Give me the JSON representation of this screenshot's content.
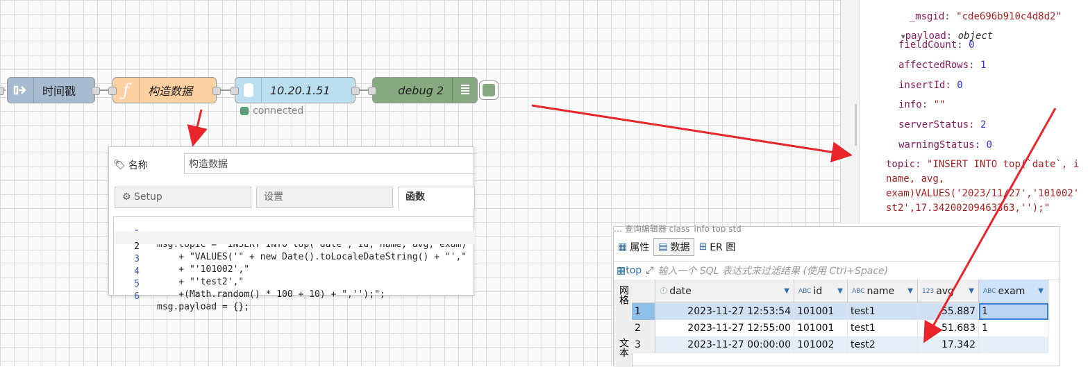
{
  "flow": {
    "nodes": [
      {
        "id": "timestamp",
        "label": "时间戳",
        "color": "#a6bbcf",
        "icon": "arrow-right-icon"
      },
      {
        "id": "function",
        "label": "构造数据",
        "color": "#fdd0a2",
        "icon": "function-icon"
      },
      {
        "id": "mysql",
        "label": "10.20.1.51",
        "color": "#e2d96e",
        "icon": "database-icon"
      },
      {
        "id": "debug",
        "label": "debug 2",
        "color": "#87a980",
        "icon": "list-icon"
      }
    ],
    "mysql_status": "connected"
  },
  "edit_panel": {
    "name_label": "名称",
    "name_value": "构造数据",
    "tabs": [
      "Setup",
      "设置",
      "函数"
    ],
    "code_lines": [
      {
        "n": "1",
        "text": "msg.topic = \"INSERT INTO top(`date`, id, name, avg, exam)\""
      },
      {
        "n": "2",
        "text": "    + \"VALUES('\" + new Date().toLocaleDateString() + \"',\""
      },
      {
        "n": "3",
        "text": "    + \"'101002',\""
      },
      {
        "n": "4",
        "text": "    + \"'test2',\""
      },
      {
        "n": "5",
        "text": "    +(Math.random() * 100 + 10) + \",'');\";"
      },
      {
        "n": "6",
        "text": "msg.payload = {};"
      }
    ]
  },
  "debug": {
    "msgid_key": "_msgid:",
    "msgid_val": "\"cde696b910c4d8d2\"",
    "payload_key": "payload:",
    "payload_type": "object",
    "fields": [
      {
        "k": "fieldCount:",
        "v": "0"
      },
      {
        "k": "affectedRows:",
        "v": "1"
      },
      {
        "k": "insertId:",
        "v": "0"
      },
      {
        "k": "info:",
        "v": "\"\""
      },
      {
        "k": "serverStatus:",
        "v": "2"
      },
      {
        "k": "warningStatus:",
        "v": "0"
      }
    ],
    "topic_key": "topic:",
    "topic_lines": [
      "\"INSERT INTO top(`date`, i",
      "name, avg,",
      "exam)VALUES('2023/11/27','101002'",
      "st2',17.34200209463363,'');\""
    ]
  },
  "db": {
    "editor_tabs": "… 查询编辑器  class_info  top  std",
    "subtabs": [
      "属性",
      "数据",
      "ER 图"
    ],
    "table_name": "top",
    "filter_placeholder": "输入一个 SQL 表达式来过滤结果 (使用 Ctrl+Space)",
    "side_tabs": [
      "网格",
      "文本"
    ],
    "columns": [
      {
        "name": "date",
        "type": "clock"
      },
      {
        "name": "id",
        "type": "ABC"
      },
      {
        "name": "name",
        "type": "ABC"
      },
      {
        "name": "avg",
        "type": "123"
      },
      {
        "name": "exam",
        "type": "ABC"
      }
    ],
    "rows": [
      {
        "n": "1",
        "date": "2023-11-27 12:53:54",
        "id": "101001",
        "name": "test1",
        "avg": "55.887",
        "exam": "1"
      },
      {
        "n": "2",
        "date": "2023-11-27 12:55:00",
        "id": "101001",
        "name": "test1",
        "avg": "51.683",
        "exam": "1"
      },
      {
        "n": "3",
        "date": "2023-11-27 00:00:00",
        "id": "101002",
        "name": "test2",
        "avg": "17.342",
        "exam": ""
      }
    ]
  },
  "colors": {
    "arrow": "#e8252b",
    "accent": "#2c6fb3"
  }
}
